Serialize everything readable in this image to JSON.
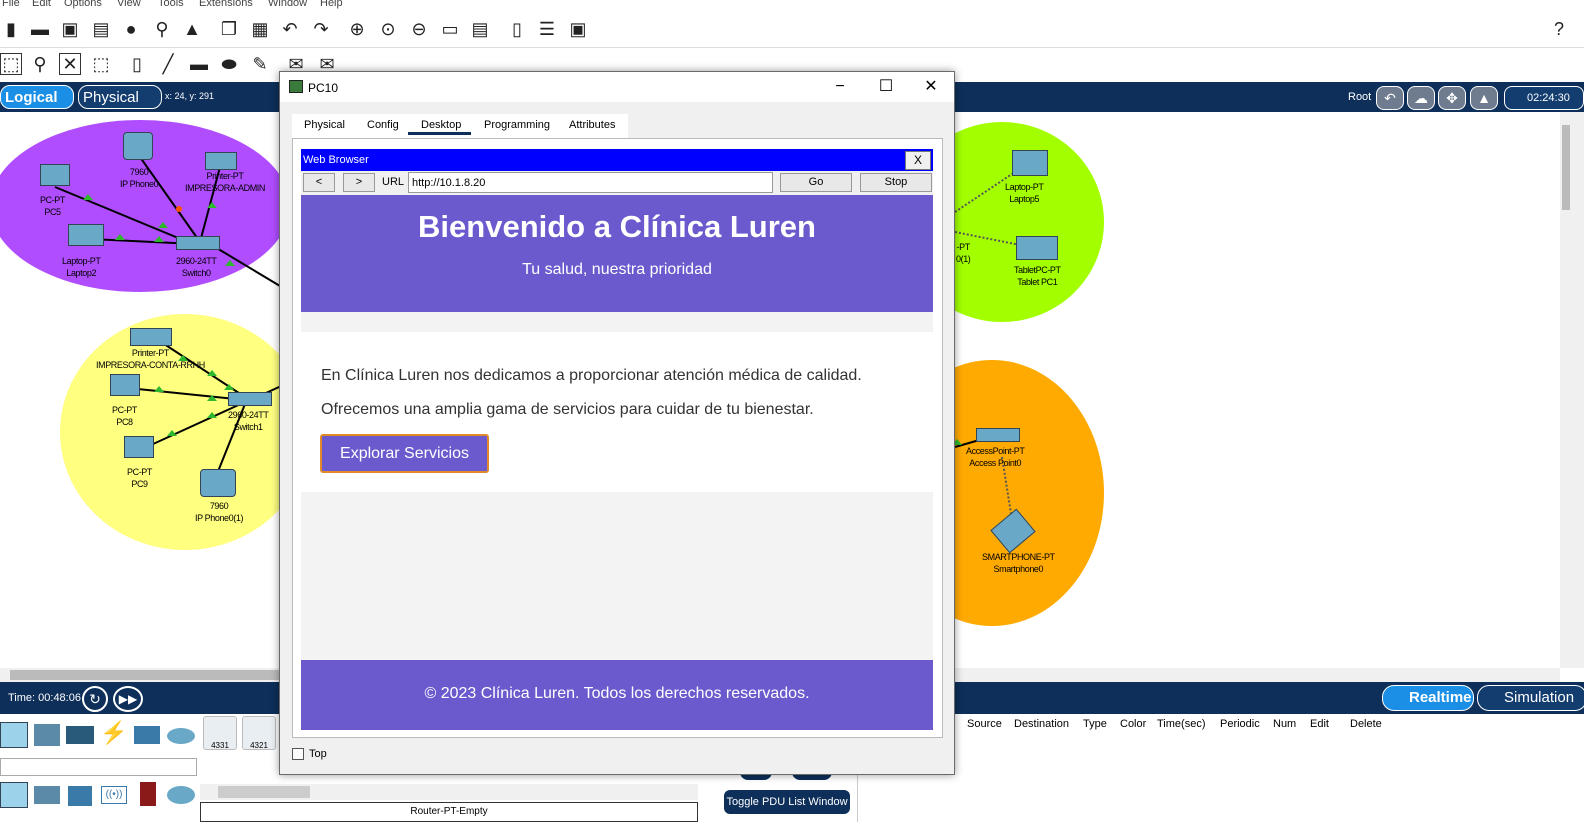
{
  "menu": [
    "File",
    "Edit",
    "Options",
    "View",
    "Tools",
    "Extensions",
    "Window",
    "Help"
  ],
  "workspace": {
    "logical_label": "Logical",
    "physical_label": "Physical",
    "coords": "x: 24, y: 291",
    "root_label": "Root",
    "clock": "02:24:30"
  },
  "devices": {
    "pc5": [
      "PC-PT",
      "PC5"
    ],
    "iphone0": [
      "7960",
      "IP Phone0"
    ],
    "printer_admin": [
      "Printer-PT",
      "IMPRESORA-ADMIN"
    ],
    "laptop2": [
      "Laptop-PT",
      "Laptop2"
    ],
    "switch0": [
      "2960-24TT",
      "Switch0"
    ],
    "printer_conta": [
      "Printer-PT",
      "IMPRESORA-CONTA-RRHH"
    ],
    "pc8": [
      "PC-PT",
      "PC8"
    ],
    "switch1": [
      "2960-24TT",
      "Switch1"
    ],
    "pc9": [
      "PC-PT",
      "PC9"
    ],
    "iphone01": [
      "7960",
      "IP Phone0(1)"
    ],
    "laptop5": [
      "Laptop-PT",
      "Laptop5"
    ],
    "partial": [
      "-PT",
      "0(1)"
    ],
    "tablet": [
      "TabletPC-PT",
      "Tablet PC1"
    ],
    "ap": [
      "AccessPoint-PT",
      "Access Point0"
    ],
    "smartphone": [
      "SMARTPHONE-PT",
      "Smartphone0"
    ]
  },
  "colors": {
    "purple_cluster": "#b04dff",
    "yellow_cluster": "#ffff80",
    "green_cluster": "#a3ff00",
    "orange_cluster": "#ffaa00",
    "nav_dark": "#0d2f5a",
    "site_purple": "#6a5acd"
  },
  "bottom": {
    "time": "Time: 00:48:06",
    "realtime": "Realtime",
    "simulation": "Simulation",
    "router_models": [
      "4331",
      "4321"
    ],
    "router_label": "Router-PT-Empty",
    "toggle_pdu": "Toggle PDU List Window",
    "pdu_columns": [
      "Source",
      "Destination",
      "Type",
      "Color",
      "Time(sec)",
      "Periodic",
      "Num",
      "Edit",
      "Delete"
    ]
  },
  "window": {
    "title": "PC10",
    "tabs": [
      "Physical",
      "Config",
      "Desktop",
      "Programming",
      "Attributes"
    ],
    "top_label": "Top"
  },
  "browser": {
    "title": "Web Browser",
    "close": "X",
    "back": "<",
    "forward": ">",
    "url_label": "URL",
    "url": "http://10.1.8.20",
    "go": "Go",
    "stop": "Stop"
  },
  "site": {
    "title": "Bienvenido a Clínica Luren",
    "subtitle": "Tu salud, nuestra prioridad",
    "p1": "En Clínica Luren nos dedicamos a proporcionar atención médica de calidad.",
    "p2": "Ofrecemos una amplia gama de servicios para cuidar de tu bienestar.",
    "button": "Explorar Servicios",
    "footer": "© 2023 Clínica Luren. Todos los derechos reservados."
  }
}
